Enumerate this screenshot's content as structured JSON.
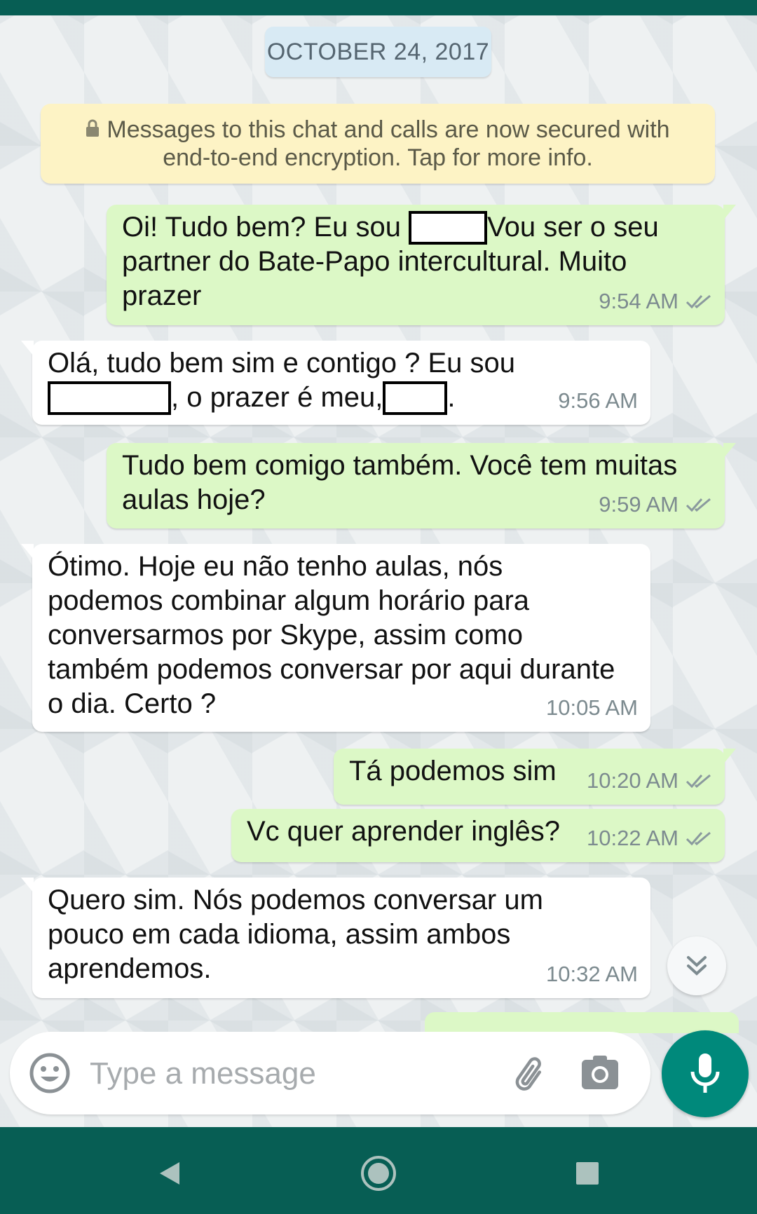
{
  "date_chip": "OCTOBER 24, 2017",
  "encryption_notice": "Messages to this chat and calls are now secured with end-to-end encryption. Tap for more info.",
  "messages": [
    {
      "direction": "out",
      "parts": [
        "Oi! Tudo bem? Eu sou ",
        "Vou ser o seu partner do Bate-Papo intercultural. Muito prazer"
      ],
      "time": "9:54 AM",
      "status": "read"
    },
    {
      "direction": "in",
      "parts": [
        "Olá, tudo bem sim e contigo ? Eu sou ",
        ", o prazer é meu,",
        "."
      ],
      "time": "9:56 AM"
    },
    {
      "direction": "out",
      "text": "Tudo bem comigo também. Você tem muitas aulas hoje?",
      "time": "9:59 AM",
      "status": "read"
    },
    {
      "direction": "in",
      "text": "Ótimo. Hoje eu não tenho aulas, nós podemos combinar algum horário para conversarmos por Skype, assim como também podemos conversar por aqui durante o dia. Certo ?",
      "time": "10:05 AM"
    },
    {
      "direction": "out",
      "text": "Tá podemos sim",
      "time": "10:20 AM",
      "status": "read"
    },
    {
      "direction": "out",
      "text": "Vc quer aprender inglês?",
      "time": "10:22 AM",
      "status": "read"
    },
    {
      "direction": "in",
      "text": "Quero sim. Nós podemos conversar um pouco em cada idioma, assim ambos aprendemos.",
      "time": "10:32 AM"
    }
  ],
  "composer": {
    "placeholder": "Type a message"
  },
  "icons": {
    "lock": "lock-icon",
    "read_receipt": "double-check-icon",
    "scroll": "chevron-double-down-icon",
    "emoji": "emoji-icon",
    "attach": "paperclip-icon",
    "camera": "camera-icon",
    "mic": "mic-icon",
    "nav_back": "back-triangle-icon",
    "nav_home": "home-circle-icon",
    "nav_recent": "recent-square-icon"
  },
  "colors": {
    "header": "#075e54",
    "outgoing": "#dcf8c6",
    "incoming": "#ffffff",
    "accent": "#00897b",
    "notice": "#fdf3c5",
    "date_chip": "#d8eaf4"
  }
}
